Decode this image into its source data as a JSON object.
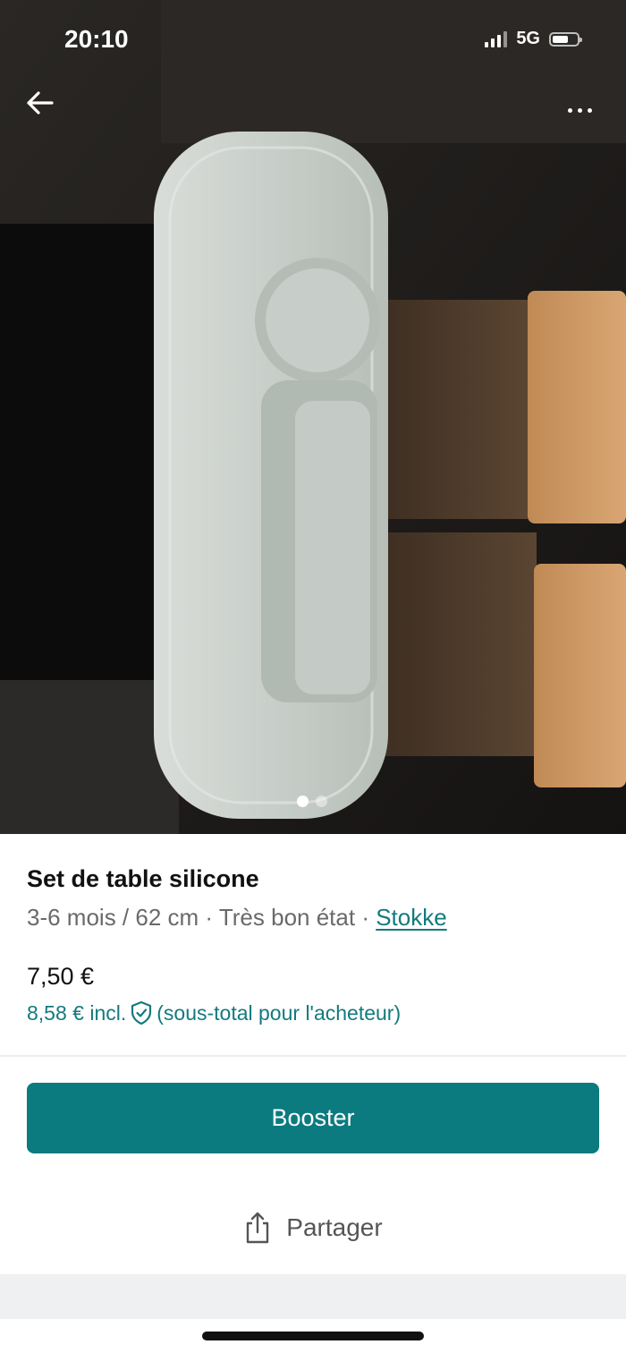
{
  "status_bar": {
    "time": "20:10",
    "network": "5G"
  },
  "gallery": {
    "image_description_icon": "placemat-photo",
    "image_count": 2,
    "active_index": 0
  },
  "listing": {
    "title": "Set de table silicone",
    "size": "3-6 mois / 62 cm",
    "separator": "·",
    "condition": "Très bon état",
    "brand": "Stokke",
    "price": "7,50 €",
    "price_incl": "8,58 € incl.",
    "price_incl_note": "(sous-total pour l'acheteur)"
  },
  "actions": {
    "booster_label": "Booster",
    "share_label": "Partager"
  },
  "colors": {
    "accent": "#0b7b80",
    "link": "#137a7f"
  }
}
